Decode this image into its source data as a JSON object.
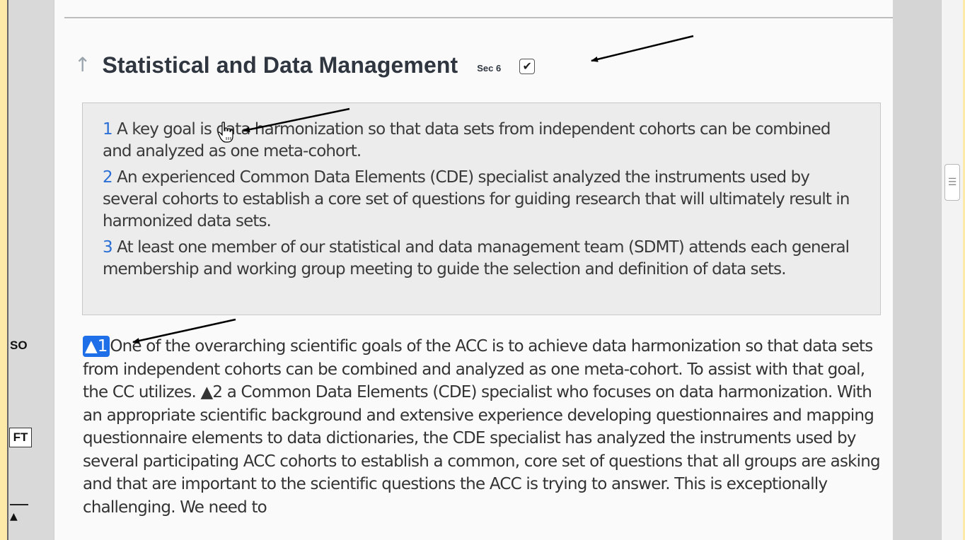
{
  "sidebar": {
    "so_label": "SO",
    "ft_label": "FT",
    "up_label": "▲"
  },
  "section": {
    "up_arrow": "↑",
    "title": "Statistical and Data Management",
    "sec_label": "Sec 6",
    "checkbox_checked": true,
    "checkbox_glyph": "✔"
  },
  "summary": {
    "items": [
      {
        "num": "1",
        "text": " A key goal is data harmonization so that data sets from independent cohorts can be combined and analyzed as one meta-cohort."
      },
      {
        "num": "2",
        "text": " An experienced Common Data Elements (CDE) specialist analyzed the instruments used by several cohorts to establish a core set of questions for guiding research that will ultimately result in harmonized data sets."
      },
      {
        "num": "3",
        "text": " At least one member of our statistical and data management team (SDMT) attends each general membership and working group meeting to guide the selection and definition of data sets."
      }
    ]
  },
  "body": {
    "marker1": "▲1",
    "part1": "One of the overarching scientific goals of the ACC is to achieve data harmonization so that data sets from independent cohorts can be combined and analyzed as one meta-cohort. To assist with that goal, the CC utilizes. ",
    "marker2": "▲2",
    "part2": " a Common Data Elements (CDE) specialist who focuses on data harmonization. With an appropriate scientific background and extensive experience developing questionnaires and mapping questionnaire elements to data dictionaries, the CDE specialist has analyzed the instruments used by several participating ACC cohorts to establish a common, core set of questions that all groups are asking and that are important to the scientific questions the ACC is trying to answer. This is exceptionally challenging. We need to"
  },
  "scrollbar": {
    "thumb_glyph": "☰"
  },
  "colors": {
    "accent_blue": "#1e6fe8",
    "link_blue": "#2a6fd6",
    "outer_background": "#fdeaa8"
  }
}
